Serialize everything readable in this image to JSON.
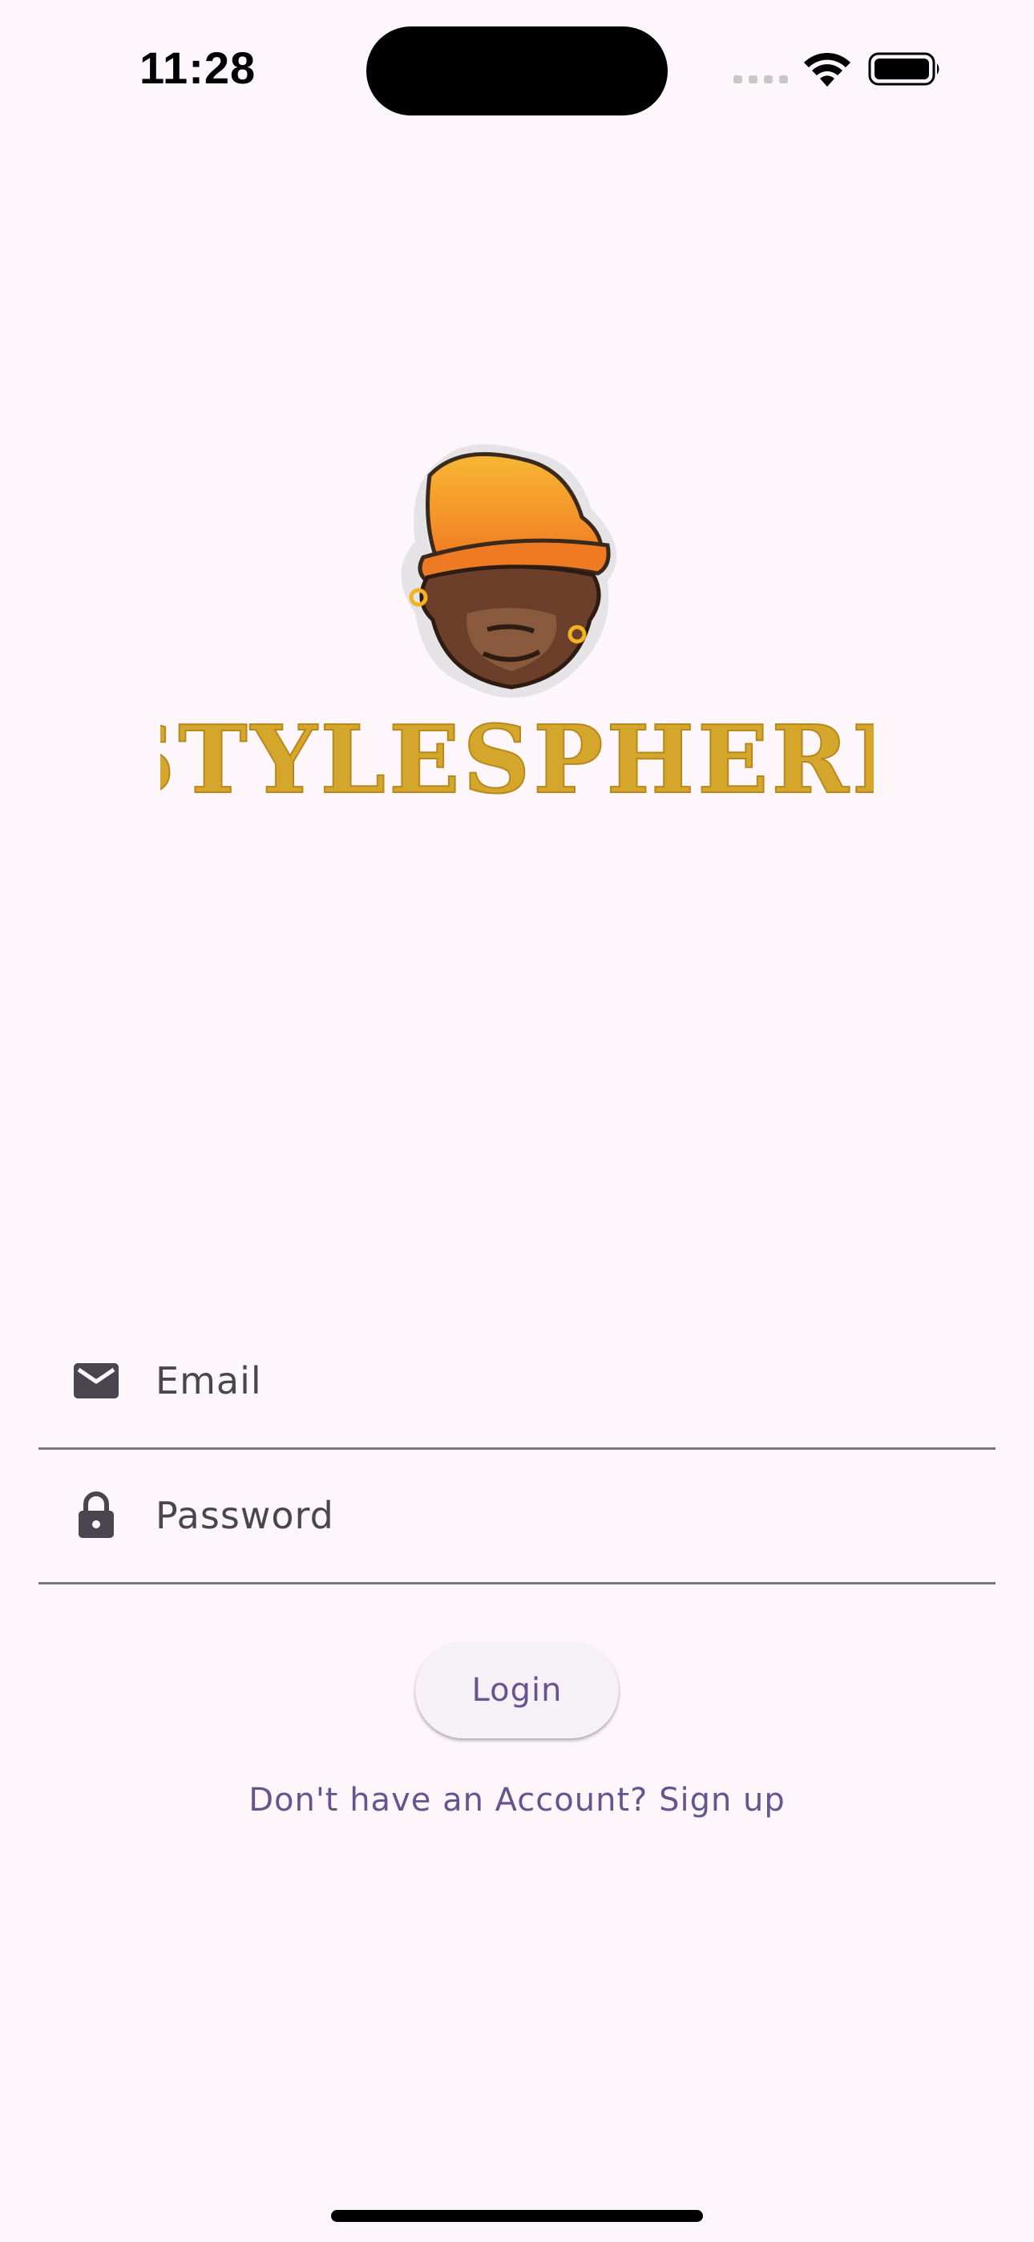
{
  "status_bar": {
    "time": "11:28",
    "signal_icon": "cellular-signal-icon",
    "wifi_icon": "wifi-icon",
    "battery_icon": "battery-icon"
  },
  "brand": {
    "logo_icon": "monkey-beanie-logo",
    "name": "STYLESPHERE",
    "accent": "#d4a72c"
  },
  "form": {
    "email": {
      "icon": "mail-icon",
      "placeholder": "Email",
      "value": ""
    },
    "password": {
      "icon": "lock-icon",
      "placeholder": "Password",
      "value": ""
    }
  },
  "actions": {
    "login_label": "Login",
    "signup_text": "Don't have an Account? Sign up"
  },
  "colors": {
    "background": "#fdf7fc",
    "primary": "#65558f",
    "divider": "#7a7680"
  }
}
